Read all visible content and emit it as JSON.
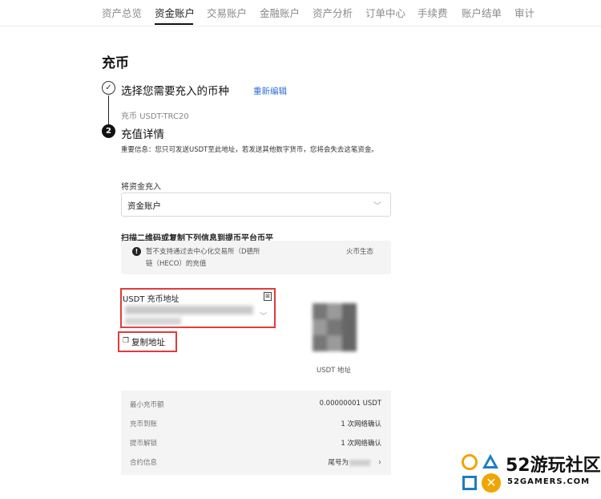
{
  "nav": {
    "items": [
      {
        "label": "资产总览",
        "active": false
      },
      {
        "label": "资金账户",
        "active": true
      },
      {
        "label": "交易账户",
        "active": false
      },
      {
        "label": "金融账户",
        "active": false
      },
      {
        "label": "资产分析",
        "active": false
      },
      {
        "label": "订单中心",
        "active": false
      },
      {
        "label": "手续费",
        "active": false
      },
      {
        "label": "账户结单",
        "active": false
      },
      {
        "label": "审计",
        "active": false
      }
    ]
  },
  "page": {
    "title": "充币"
  },
  "step1": {
    "icon": "check-icon",
    "title": "选择您需要充入的币种",
    "reedit_label": "重新编辑",
    "coin_prefix": "充币",
    "coin_value": "USDT-TRC20"
  },
  "step2": {
    "number": "2",
    "title": "充值详情",
    "important": "重要信息：您只可发送USDT至此地址，若发送其他数字货币，您将会失去这笔资金。"
  },
  "deposit_to": {
    "label": "将资金充入",
    "selected": "资金账户",
    "icon": "chevron-down-icon"
  },
  "scan": {
    "label": "扫描二维码或复制下列信息到提币平台币平"
  },
  "notice": {
    "icon": "info-icon",
    "line1": "暂不支持通过去中心化交易所（D德所",
    "line1_tail": "火币生态",
    "line2": "链（HECO）的充值"
  },
  "address": {
    "label": "USDT 充币地址",
    "icon": "qr-toggle-icon"
  },
  "copy": {
    "icon": "copy-icon",
    "label": "复制地址"
  },
  "qr": {
    "label": "USDT 地址"
  },
  "info_rows": [
    {
      "key": "最小充币额",
      "value": "0.00000001 USDT"
    },
    {
      "key": "充币到账",
      "value": "1 次网络确认"
    },
    {
      "key": "提币解锁",
      "value": "1 次网络确认"
    },
    {
      "key": "合约信息",
      "value": "尾号为"
    }
  ],
  "watermark": {
    "number": "52",
    "name": "游玩社区",
    "domain": "52GAMERS.COM",
    "colors": {
      "orange": "#f0a500",
      "blue": "#1a7fc4"
    }
  },
  "colors": {
    "highlight_red": "#e23b3b",
    "link_blue": "#2f6fd8"
  }
}
